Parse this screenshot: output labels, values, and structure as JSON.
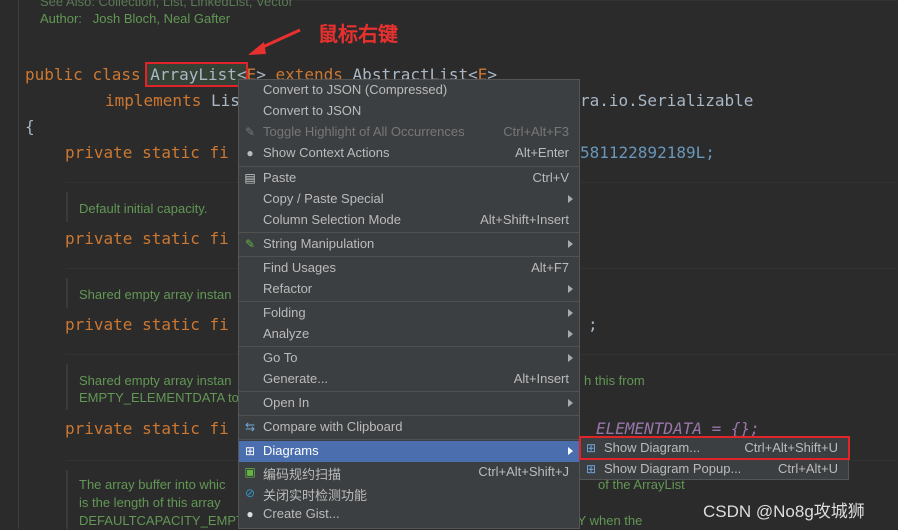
{
  "annotation": "鼠标右键",
  "watermark": "CSDN @No8g攻城狮",
  "code": {
    "top_doc": {
      "see_line": "See Also: Collection, List, LinkedList, Vector",
      "author_line": "Author:   Josh Bloch, Neal Gafter"
    },
    "line_class": {
      "kw1": "public ",
      "kw2": "class ",
      "name": "ArrayList",
      "lt": "<",
      "type_e": "E",
      "gt": "> ",
      "kw3": "extends ",
      "super": "AbstractList",
      "lt2": "<",
      "type_e2": "E",
      "gt2": ">"
    },
    "line_implements": {
      "kw": "implements ",
      "list": "Lis",
      "tail": "ra.io.Serializable"
    },
    "brace": "{",
    "private_prefix": "private static fi",
    "serial_tail": "581122892189L;",
    "empty_tail": ";",
    "default_tail": "ELEMENTDATA = {};",
    "docs": {
      "d1": "Default initial capacity.",
      "d2": "Shared empty array instan",
      "d3a": "Shared empty array instan",
      "d3a_tail": "h this from",
      "d3b": "EMPTY_ELEMENTDATA to",
      "d4a": "The array buffer into whic",
      "d4a_tail": "of the ArrayList",
      "d4b": "is the length of this array",
      "d4c": "DEFAULTCAPACITY_EMPT",
      "d4c_tail": "ITY when the"
    }
  },
  "menu": {
    "items": [
      {
        "label": "Convert to JSON (Compressed)",
        "shortcut": "",
        "submenu": false,
        "disabled": false,
        "icon": ""
      },
      {
        "label": "Convert to JSON",
        "shortcut": "",
        "submenu": false,
        "disabled": false,
        "icon": ""
      },
      {
        "label": "Toggle Highlight of All Occurrences",
        "shortcut": "Ctrl+Alt+F3",
        "submenu": false,
        "disabled": true,
        "icon": "highlighter-icon"
      },
      {
        "label": "Show Context Actions",
        "shortcut": "Alt+Enter",
        "submenu": false,
        "disabled": false,
        "icon": "lightbulb-icon"
      },
      {
        "label": "Paste",
        "shortcut": "Ctrl+V",
        "submenu": false,
        "disabled": false,
        "icon": "clipboard-icon"
      },
      {
        "label": "Copy / Paste Special",
        "shortcut": "",
        "submenu": true,
        "disabled": false,
        "icon": ""
      },
      {
        "label": "Column Selection Mode",
        "shortcut": "Alt+Shift+Insert",
        "submenu": false,
        "disabled": false,
        "icon": ""
      },
      {
        "label": "String Manipulation",
        "shortcut": "",
        "submenu": true,
        "disabled": false,
        "icon": "pencil-icon"
      },
      {
        "label": "Find Usages",
        "shortcut": "Alt+F7",
        "submenu": false,
        "disabled": false,
        "icon": ""
      },
      {
        "label": "Refactor",
        "shortcut": "",
        "submenu": true,
        "disabled": false,
        "icon": ""
      },
      {
        "label": "Folding",
        "shortcut": "",
        "submenu": true,
        "disabled": false,
        "icon": ""
      },
      {
        "label": "Analyze",
        "shortcut": "",
        "submenu": true,
        "disabled": false,
        "icon": ""
      },
      {
        "label": "Go To",
        "shortcut": "",
        "submenu": true,
        "disabled": false,
        "icon": ""
      },
      {
        "label": "Generate...",
        "shortcut": "Alt+Insert",
        "submenu": false,
        "disabled": false,
        "icon": ""
      },
      {
        "label": "Open In",
        "shortcut": "",
        "submenu": true,
        "disabled": false,
        "icon": ""
      },
      {
        "label": "Compare with Clipboard",
        "shortcut": "",
        "submenu": false,
        "disabled": false,
        "icon": "compare-icon"
      },
      {
        "label": "Diagrams",
        "shortcut": "",
        "submenu": true,
        "disabled": false,
        "icon": "diagram-icon"
      },
      {
        "label": "编码规约扫描",
        "shortcut": "Ctrl+Alt+Shift+J",
        "submenu": false,
        "disabled": false,
        "icon": "scan-icon"
      },
      {
        "label": "关闭实时检测功能",
        "shortcut": "",
        "submenu": false,
        "disabled": false,
        "icon": "block-icon"
      },
      {
        "label": "Create Gist...",
        "shortcut": "",
        "submenu": false,
        "disabled": false,
        "icon": "github-icon"
      }
    ]
  },
  "submenu": {
    "items": [
      {
        "label": "Show Diagram...",
        "shortcut": "Ctrl+Alt+Shift+U",
        "icon": "diagram-icon"
      },
      {
        "label": "Show Diagram Popup...",
        "shortcut": "Ctrl+Alt+U",
        "icon": "diagram-icon"
      }
    ]
  },
  "colors": {
    "accent": "#4b6eaf",
    "highlight_box": "#e0242a",
    "annotation": "#e8312f"
  }
}
